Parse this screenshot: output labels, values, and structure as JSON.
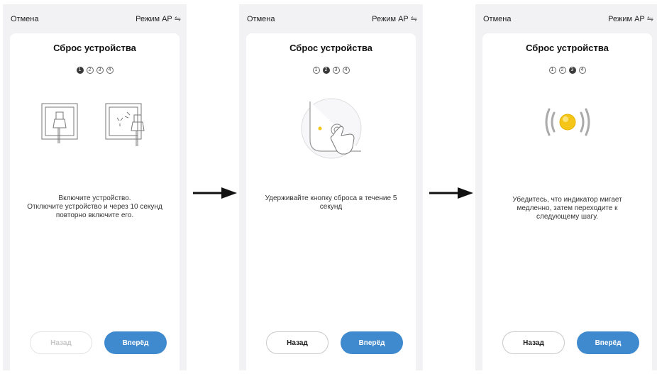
{
  "header": {
    "cancel_label": "Отмена",
    "mode_label": "Режим AP",
    "mode_icon": "wifi-icon"
  },
  "screens": [
    {
      "title": "Сброс устройства",
      "steps": [
        "1",
        "2",
        "3",
        "4"
      ],
      "active_step": 1,
      "description": "Включите устройство.\nОтключите устройство и через 10 секунд повторно включите его.",
      "back_label": "Назад",
      "back_enabled": false,
      "next_label": "Вперёд"
    },
    {
      "title": "Сброс устройства",
      "steps": [
        "1",
        "2",
        "3",
        "4"
      ],
      "active_step": 2,
      "description": "Удерживайте кнопку сброса в течение 5 секунд",
      "back_label": "Назад",
      "back_enabled": true,
      "next_label": "Вперёд"
    },
    {
      "title": "Сброс устройства",
      "steps": [
        "1",
        "2",
        "3",
        "4"
      ],
      "active_step": 3,
      "description": "Убедитесь, что индикатор мигает медленно, затем переходите к следующему шагу.",
      "back_label": "Назад",
      "back_enabled": true,
      "next_label": "Вперёд"
    }
  ],
  "colors": {
    "accent": "#3f89cf",
    "indicator": "#f5c518"
  }
}
